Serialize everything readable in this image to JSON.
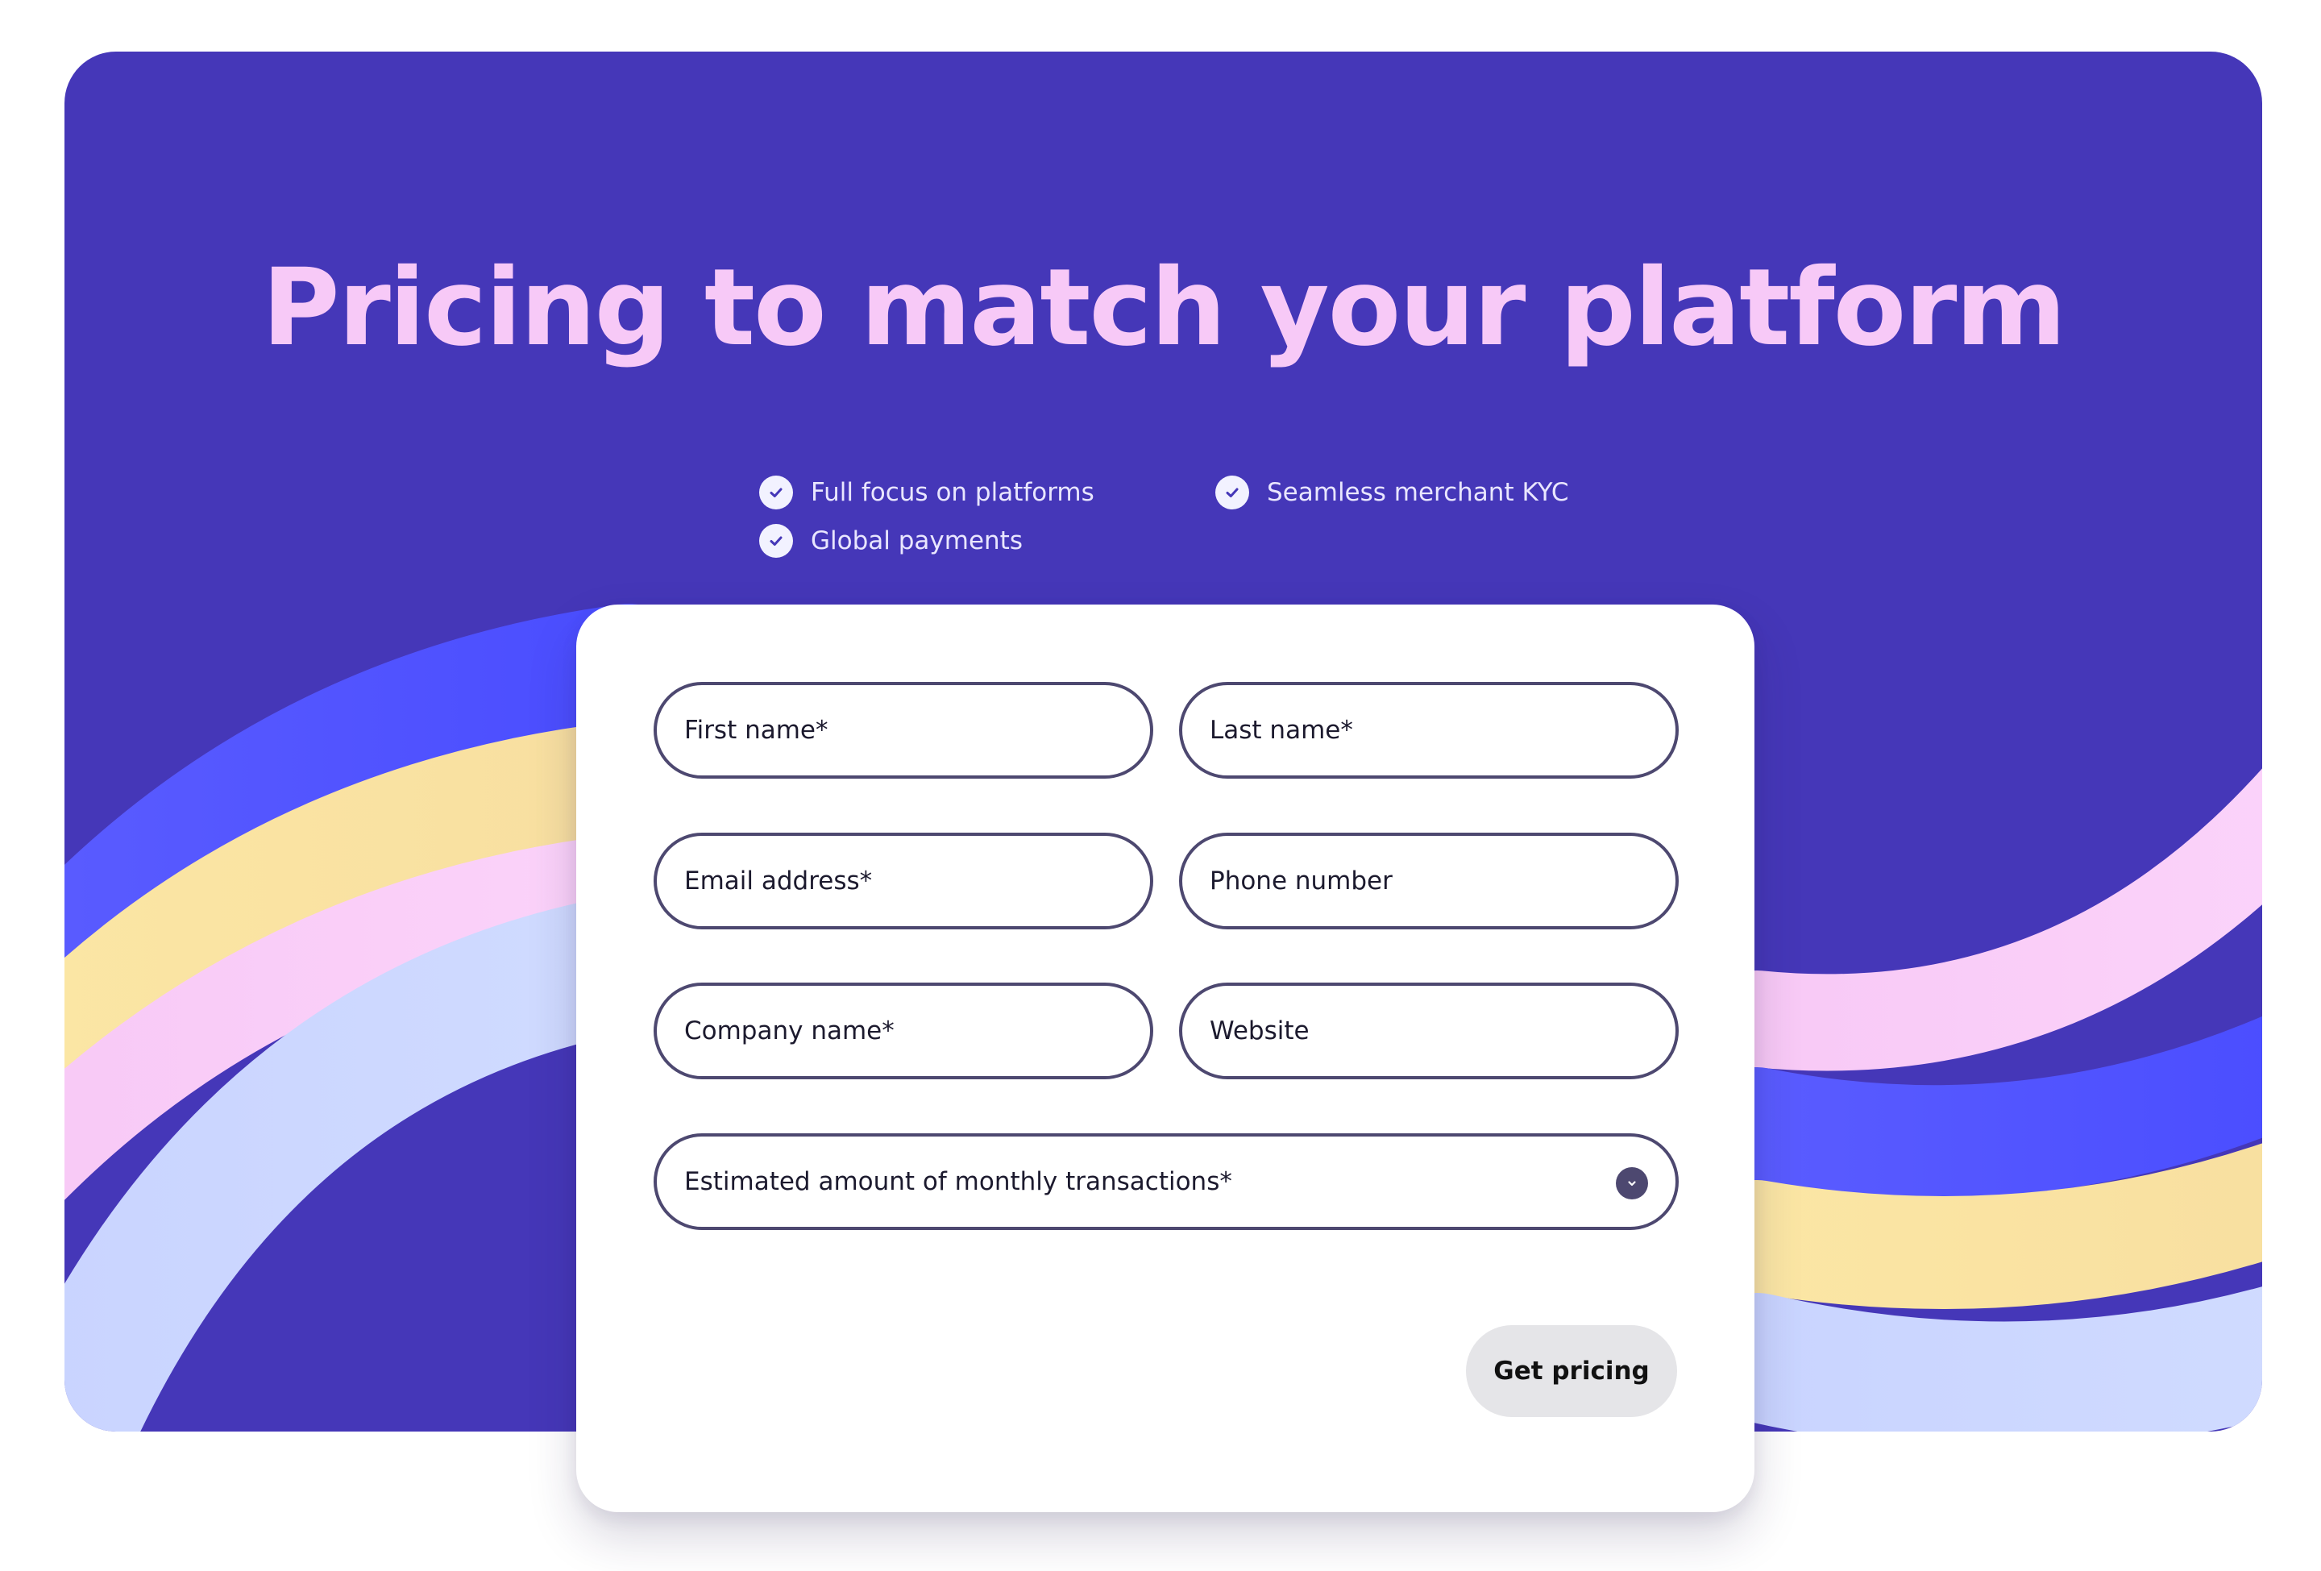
{
  "hero": {
    "title": "Pricing to match your platform",
    "background_color": "#4537b8",
    "title_color": "#f7c9f7",
    "features": [
      {
        "label": "Full focus on platforms",
        "icon": "check-circle-icon"
      },
      {
        "label": "Seamless merchant KYC",
        "icon": "check-circle-icon"
      },
      {
        "label": "Global payments",
        "icon": "check-circle-icon"
      }
    ]
  },
  "form": {
    "first_name": {
      "placeholder": "First name*"
    },
    "last_name": {
      "placeholder": "Last name*"
    },
    "email": {
      "placeholder": "Email address*"
    },
    "phone": {
      "placeholder": "Phone number"
    },
    "company": {
      "placeholder": "Company name*"
    },
    "website": {
      "placeholder": "Website"
    },
    "transactions": {
      "placeholder": "Estimated amount of monthly transactions*",
      "icon": "chevron-down-icon"
    },
    "submit_label": "Get pricing"
  }
}
